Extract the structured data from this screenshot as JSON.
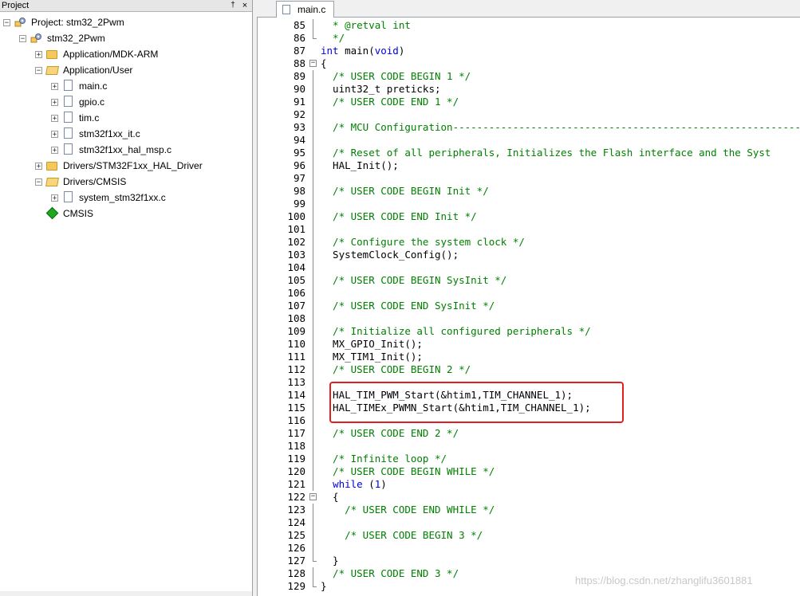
{
  "project_pane": {
    "title": "Project",
    "pin_glyph": "†",
    "close_glyph": "×",
    "tree": [
      {
        "label": "Project: stm32_2Pwm",
        "icon": "project-icon",
        "expander": "−"
      },
      {
        "label": "stm32_2Pwm",
        "icon": "target-icon",
        "expander": "−"
      },
      {
        "label": "Application/MDK-ARM",
        "icon": "folder-icon",
        "expander": "+"
      },
      {
        "label": "Application/User",
        "icon": "folder-open-icon",
        "expander": "−"
      },
      {
        "label": "main.c",
        "icon": "file-icon",
        "expander": "+"
      },
      {
        "label": "gpio.c",
        "icon": "file-icon",
        "expander": "+"
      },
      {
        "label": "tim.c",
        "icon": "file-icon",
        "expander": "+"
      },
      {
        "label": "stm32f1xx_it.c",
        "icon": "file-icon",
        "expander": "+"
      },
      {
        "label": "stm32f1xx_hal_msp.c",
        "icon": "file-icon",
        "expander": "+"
      },
      {
        "label": "Drivers/STM32F1xx_HAL_Driver",
        "icon": "folder-icon",
        "expander": "+"
      },
      {
        "label": "Drivers/CMSIS",
        "icon": "folder-open-icon",
        "expander": "−"
      },
      {
        "label": "system_stm32f1xx.c",
        "icon": "file-icon",
        "expander": "+"
      },
      {
        "label": "CMSIS",
        "icon": "cmsis-icon",
        "expander": ""
      }
    ]
  },
  "editor": {
    "tab_label": "main.c",
    "lines": [
      {
        "n": "85",
        "text": "  * @retval int",
        "cls": "c",
        "fold": "bar"
      },
      {
        "n": "86",
        "text": "  */",
        "cls": "c",
        "fold": "end"
      },
      {
        "n": "87",
        "text": "int main(void)",
        "cls": "mixed-main",
        "fold": ""
      },
      {
        "n": "88",
        "text": "{",
        "cls": "p",
        "fold": "box"
      },
      {
        "n": "89",
        "text": "  /* USER CODE BEGIN 1 */",
        "cls": "c",
        "fold": "bar"
      },
      {
        "n": "90",
        "text": "  uint32_t preticks;",
        "cls": "p",
        "fold": "bar"
      },
      {
        "n": "91",
        "text": "  /* USER CODE END 1 */",
        "cls": "c",
        "fold": "bar"
      },
      {
        "n": "92",
        "text": "",
        "cls": "p",
        "fold": "bar"
      },
      {
        "n": "93",
        "text": "  /* MCU Configuration----------------------------------------------------------",
        "cls": "c",
        "fold": "bar"
      },
      {
        "n": "94",
        "text": "",
        "cls": "p",
        "fold": "bar"
      },
      {
        "n": "95",
        "text": "  /* Reset of all peripherals, Initializes the Flash interface and the Syst",
        "cls": "c",
        "fold": "bar"
      },
      {
        "n": "96",
        "text": "  HAL_Init();",
        "cls": "p",
        "fold": "bar"
      },
      {
        "n": "97",
        "text": "",
        "cls": "p",
        "fold": "bar"
      },
      {
        "n": "98",
        "text": "  /* USER CODE BEGIN Init */",
        "cls": "c",
        "fold": "bar"
      },
      {
        "n": "99",
        "text": "",
        "cls": "p",
        "fold": "bar"
      },
      {
        "n": "100",
        "text": "  /* USER CODE END Init */",
        "cls": "c",
        "fold": "bar"
      },
      {
        "n": "101",
        "text": "",
        "cls": "p",
        "fold": "bar"
      },
      {
        "n": "102",
        "text": "  /* Configure the system clock */",
        "cls": "c",
        "fold": "bar"
      },
      {
        "n": "103",
        "text": "  SystemClock_Config();",
        "cls": "p",
        "fold": "bar"
      },
      {
        "n": "104",
        "text": "",
        "cls": "p",
        "fold": "bar"
      },
      {
        "n": "105",
        "text": "  /* USER CODE BEGIN SysInit */",
        "cls": "c",
        "fold": "bar"
      },
      {
        "n": "106",
        "text": "",
        "cls": "p",
        "fold": "bar"
      },
      {
        "n": "107",
        "text": "  /* USER CODE END SysInit */",
        "cls": "c",
        "fold": "bar"
      },
      {
        "n": "108",
        "text": "",
        "cls": "p",
        "fold": "bar"
      },
      {
        "n": "109",
        "text": "  /* Initialize all configured peripherals */",
        "cls": "c",
        "fold": "bar"
      },
      {
        "n": "110",
        "text": "  MX_GPIO_Init();",
        "cls": "p",
        "fold": "bar"
      },
      {
        "n": "111",
        "text": "  MX_TIM1_Init();",
        "cls": "p",
        "fold": "bar"
      },
      {
        "n": "112",
        "text": "  /* USER CODE BEGIN 2 */",
        "cls": "c",
        "fold": "bar"
      },
      {
        "n": "113",
        "text": "",
        "cls": "p",
        "fold": "bar"
      },
      {
        "n": "114",
        "text": "  HAL_TIM_PWM_Start(&htim1,TIM_CHANNEL_1);",
        "cls": "p",
        "fold": "bar"
      },
      {
        "n": "115",
        "text": "  HAL_TIMEx_PWMN_Start(&htim1,TIM_CHANNEL_1);",
        "cls": "p",
        "fold": "bar"
      },
      {
        "n": "116",
        "text": "",
        "cls": "p",
        "fold": "bar"
      },
      {
        "n": "117",
        "text": "  /* USER CODE END 2 */",
        "cls": "c",
        "fold": "bar"
      },
      {
        "n": "118",
        "text": "",
        "cls": "p",
        "fold": "bar"
      },
      {
        "n": "119",
        "text": "  /* Infinite loop */",
        "cls": "c",
        "fold": "bar"
      },
      {
        "n": "120",
        "text": "  /* USER CODE BEGIN WHILE */",
        "cls": "c",
        "fold": "bar"
      },
      {
        "n": "121",
        "text": "  while (1)",
        "cls": "mixed-while",
        "fold": "bar"
      },
      {
        "n": "122",
        "text": "  {",
        "cls": "p",
        "fold": "box"
      },
      {
        "n": "123",
        "text": "    /* USER CODE END WHILE */",
        "cls": "c",
        "fold": "bar"
      },
      {
        "n": "124",
        "text": "",
        "cls": "p",
        "fold": "bar"
      },
      {
        "n": "125",
        "text": "    /* USER CODE BEGIN 3 */",
        "cls": "c",
        "fold": "bar"
      },
      {
        "n": "126",
        "text": "",
        "cls": "p",
        "fold": "bar"
      },
      {
        "n": "127",
        "text": "  }",
        "cls": "p",
        "fold": "end"
      },
      {
        "n": "128",
        "text": "  /* USER CODE END 3 */",
        "cls": "c",
        "fold": "bar"
      },
      {
        "n": "129",
        "text": "}",
        "cls": "p",
        "fold": "end"
      }
    ]
  },
  "watermark": "https://blog.csdn.net/zhanglifu3601881",
  "colors": {
    "comment": "#008000",
    "keyword": "#0000e0",
    "highlight_box": "#e02020"
  }
}
